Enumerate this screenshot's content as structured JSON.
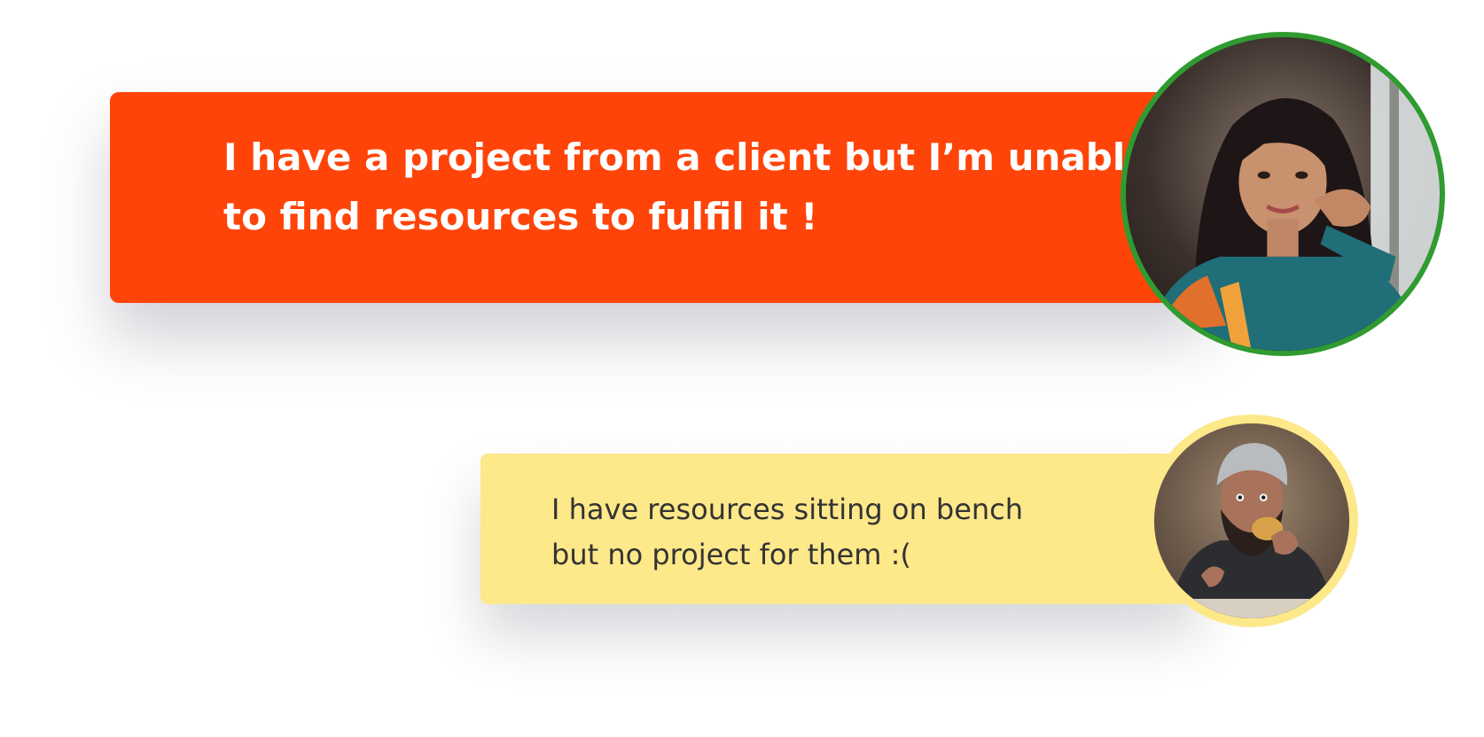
{
  "messages": {
    "client": {
      "line1": "I have a project from a client but I’m unable",
      "line2": "to find resources to fulfil it !"
    },
    "bench": {
      "line1": "I have resources sitting on bench",
      "line2": "but no project for them :("
    }
  },
  "colors": {
    "orange_card": "#ff4409",
    "yellow_card": "#fde88a",
    "woman_ring": "#2f9b30",
    "man_ring": "#fde88a"
  },
  "icons": {
    "woman": "woman-avatar-photo",
    "man": "man-avatar-photo"
  }
}
